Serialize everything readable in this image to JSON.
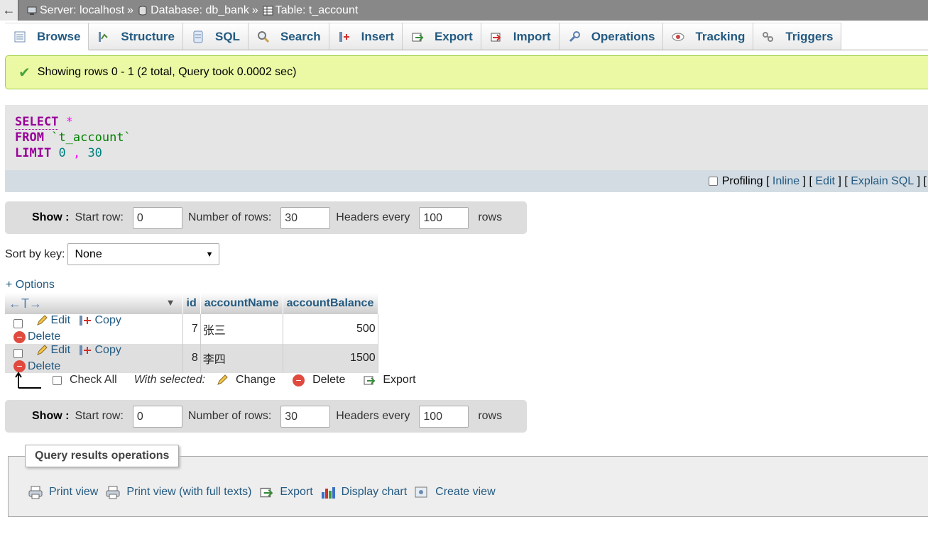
{
  "breadcrumb": {
    "back_glyph": "←",
    "server": "Server: localhost",
    "database": "Database: db_bank",
    "table": "Table: t_account",
    "separator": "»"
  },
  "tabs": [
    {
      "label": "Browse",
      "icon": "browse-icon",
      "active": true
    },
    {
      "label": "Structure",
      "icon": "structure-icon"
    },
    {
      "label": "SQL",
      "icon": "sql-icon"
    },
    {
      "label": "Search",
      "icon": "search-icon"
    },
    {
      "label": "Insert",
      "icon": "insert-icon"
    },
    {
      "label": "Export",
      "icon": "export-icon"
    },
    {
      "label": "Import",
      "icon": "import-icon"
    },
    {
      "label": "Operations",
      "icon": "wrench-icon"
    },
    {
      "label": "Tracking",
      "icon": "eye-icon"
    },
    {
      "label": "Triggers",
      "icon": "triggers-icon"
    }
  ],
  "message": {
    "text": "Showing rows 0 - 1 (2 total, Query took 0.0002 sec)",
    "color": "#ebf8a4"
  },
  "sql": {
    "select": "SELECT",
    "star": "*",
    "from": "FROM",
    "table": "`t_account`",
    "limit": "LIMIT",
    "offset": "0",
    "comma": ",",
    "count": "30"
  },
  "sql_tools": {
    "profiling": "Profiling",
    "inline": "Inline",
    "edit": "Edit",
    "explain": "Explain SQL",
    "open_bracket": "[",
    "close_bracket": "]"
  },
  "nav": {
    "show": "Show :",
    "start_row_label": "Start row:",
    "start_row_value": "0",
    "num_rows_label": "Number of rows:",
    "num_rows_value": "30",
    "headers_label": "Headers every",
    "headers_value": "100",
    "rows_label": "rows"
  },
  "sort": {
    "label": "Sort by key:",
    "selected": "None"
  },
  "options_link": "+ Options",
  "table": {
    "arrows": "←T→",
    "columns": [
      "id",
      "accountName",
      "accountBalance"
    ],
    "actions": {
      "edit": "Edit",
      "copy": "Copy",
      "delete": "Delete"
    },
    "rows": [
      {
        "id": "7",
        "accountName": "张三",
        "accountBalance": "500"
      },
      {
        "id": "8",
        "accountName": "李四",
        "accountBalance": "1500"
      }
    ]
  },
  "bulk": {
    "check_all": "Check All",
    "with_selected": "With selected:",
    "change": "Change",
    "delete": "Delete",
    "export": "Export"
  },
  "query_ops": {
    "legend": "Query results operations",
    "links": [
      "Print view",
      "Print view (with full texts)",
      "Export",
      "Display chart",
      "Create view"
    ]
  },
  "colors": {
    "link": "#235a81",
    "keyword": "#990099",
    "success_border": "#a2d246"
  }
}
